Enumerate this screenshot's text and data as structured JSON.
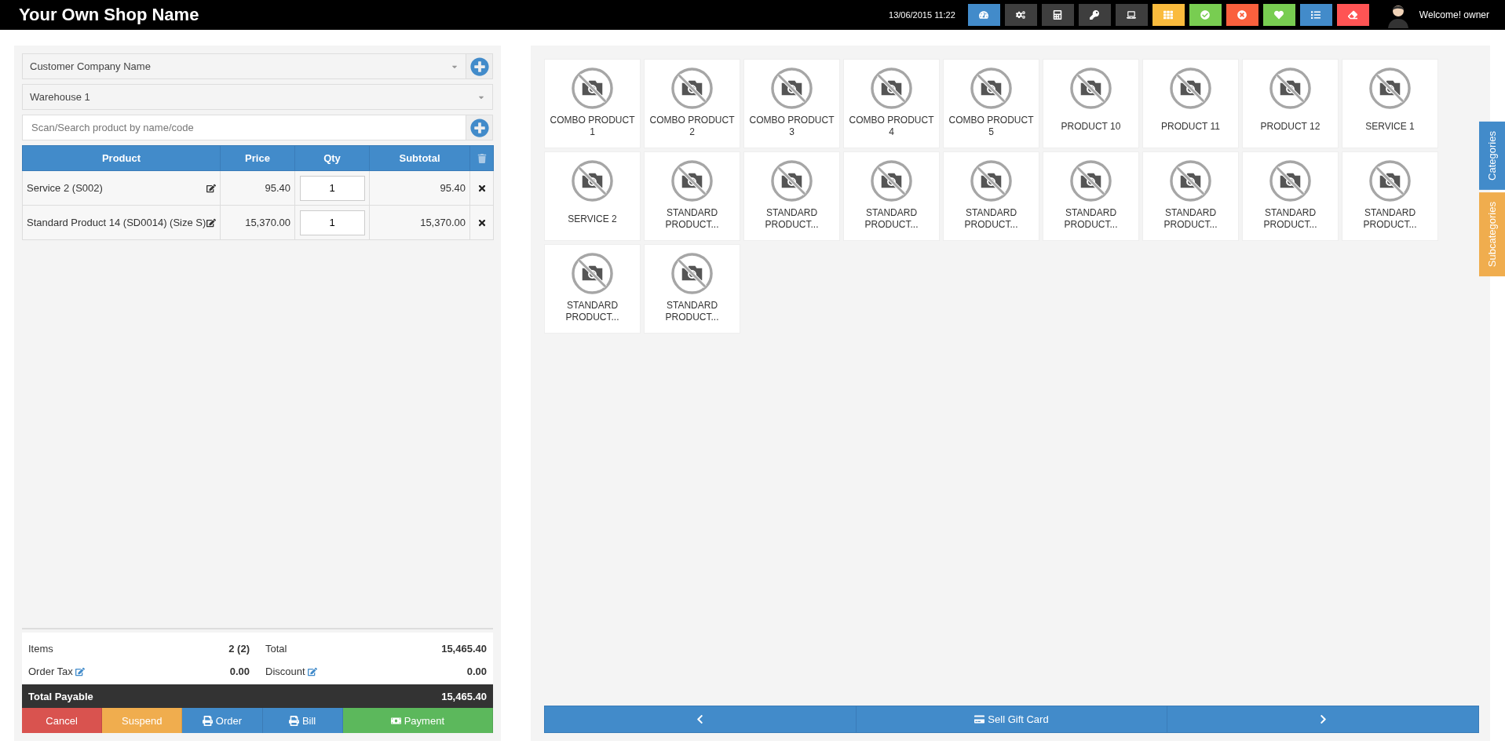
{
  "header": {
    "title": "Your Own Shop Name",
    "datetime": "13/06/2015 11:22",
    "welcome": "Welcome! owner"
  },
  "toolbar": [
    {
      "kind": "dashboard",
      "color": "#428bca"
    },
    {
      "kind": "settings",
      "color": "#3e3e3e"
    },
    {
      "kind": "calculator",
      "color": "#3e3e3e"
    },
    {
      "kind": "key",
      "color": "#3e3e3e"
    },
    {
      "kind": "laptop",
      "color": "#3e3e3e"
    },
    {
      "kind": "grid",
      "color": "#fabb3d"
    },
    {
      "kind": "check",
      "color": "#78cd51"
    },
    {
      "kind": "cancel",
      "color": "#fa603d"
    },
    {
      "kind": "heart",
      "color": "#78cd51"
    },
    {
      "kind": "list",
      "color": "#428bca"
    },
    {
      "kind": "eraser",
      "color": "#ff5454"
    }
  ],
  "customer": {
    "value": "Customer Company Name"
  },
  "warehouse": {
    "value": "Warehouse 1"
  },
  "search": {
    "placeholder": "Scan/Search product by name/code"
  },
  "order_table": {
    "columns": [
      "Product",
      "Price",
      "Qty",
      "Subtotal"
    ],
    "rows": [
      {
        "product": "Service 2 (S002)",
        "price": "95.40",
        "qty": "1",
        "subtotal": "95.40"
      },
      {
        "product": "Standard Product 14 (SD0014) (Size S)",
        "price": "15,370.00",
        "qty": "1",
        "subtotal": "15,370.00"
      }
    ]
  },
  "totals": {
    "items_label": "Items",
    "items": "2 (2)",
    "total_label": "Total",
    "total": "15,465.40",
    "tax_label": "Order Tax",
    "tax": "0.00",
    "discount_label": "Discount",
    "discount": "0.00",
    "payable_label": "Total Payable",
    "payable": "15,465.40"
  },
  "actions": [
    {
      "kind": "cancel",
      "label": "Cancel"
    },
    {
      "kind": "suspend",
      "label": "Suspend"
    },
    {
      "kind": "order",
      "label": "Order"
    },
    {
      "kind": "bill",
      "label": "Bill"
    },
    {
      "kind": "payment",
      "label": "Payment"
    }
  ],
  "products": [
    {
      "name": "COMBO PRODUCT 1"
    },
    {
      "name": "COMBO PRODUCT 2"
    },
    {
      "name": "COMBO PRODUCT 3"
    },
    {
      "name": "COMBO PRODUCT 4"
    },
    {
      "name": "COMBO PRODUCT 5"
    },
    {
      "name": "PRODUCT 10"
    },
    {
      "name": "PRODUCT 11"
    },
    {
      "name": "PRODUCT 12"
    },
    {
      "name": "SERVICE 1"
    },
    {
      "name": "SERVICE 2"
    },
    {
      "name": "STANDARD PRODUCT..."
    },
    {
      "name": "STANDARD PRODUCT..."
    },
    {
      "name": "STANDARD PRODUCT..."
    },
    {
      "name": "STANDARD PRODUCT..."
    },
    {
      "name": "STANDARD PRODUCT..."
    },
    {
      "name": "STANDARD PRODUCT..."
    },
    {
      "name": "STANDARD PRODUCT..."
    },
    {
      "name": "STANDARD PRODUCT..."
    },
    {
      "name": "STANDARD PRODUCT..."
    },
    {
      "name": "STANDARD PRODUCT..."
    }
  ],
  "pager": {
    "gift_card": "Sell Gift Card"
  },
  "side_tabs": [
    {
      "label": "Categories",
      "color": "#428bca"
    },
    {
      "label": "Subcategories",
      "color": "#f0ad4e"
    }
  ]
}
